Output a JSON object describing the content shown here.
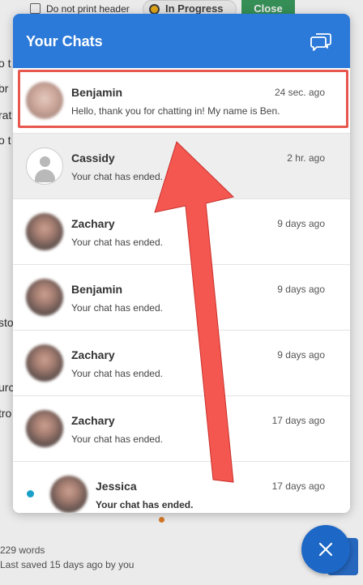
{
  "background_page": {
    "checkbox_label": "Do not print header",
    "status_label": "In Progress",
    "close_label": "Close",
    "text_fragments": [
      "o t",
      "br",
      "rat",
      "o t",
      "sto",
      "urc",
      "tro"
    ],
    "word_count": "229 words",
    "last_saved": "Last saved 15 days ago by you"
  },
  "widget": {
    "title": "Your Chats",
    "header_color": "#2b79d8",
    "new_chat_icon": "chat-bubbles-icon"
  },
  "chats": [
    {
      "name": "Benjamin",
      "time": "24 sec. ago",
      "preview": "Hello, thank you for chatting in! My name is Ben.",
      "avatar": "photo"
    },
    {
      "name": "Cassidy",
      "time": "2 hr. ago",
      "preview": "Your chat has ended.",
      "avatar": "default-user-icon"
    },
    {
      "name": "Zachary",
      "time": "9 days ago",
      "preview": "Your chat has ended.",
      "avatar": "photo"
    },
    {
      "name": "Benjamin",
      "time": "9 days ago",
      "preview": "Your chat has ended.",
      "avatar": "photo"
    },
    {
      "name": "Zachary",
      "time": "9 days ago",
      "preview": "Your chat has ended.",
      "avatar": "photo"
    },
    {
      "name": "Zachary",
      "time": "17 days ago",
      "preview": "Your chat has ended.",
      "avatar": "photo"
    },
    {
      "name": "Jessica",
      "time": "17 days ago",
      "preview": "Your chat has ended.",
      "avatar": "photo",
      "unread": true
    }
  ],
  "fab": {
    "icon": "close-icon",
    "color": "#1d67c6"
  },
  "annotation": {
    "color": "#f3574f",
    "type": "arrow-and-highlight"
  }
}
